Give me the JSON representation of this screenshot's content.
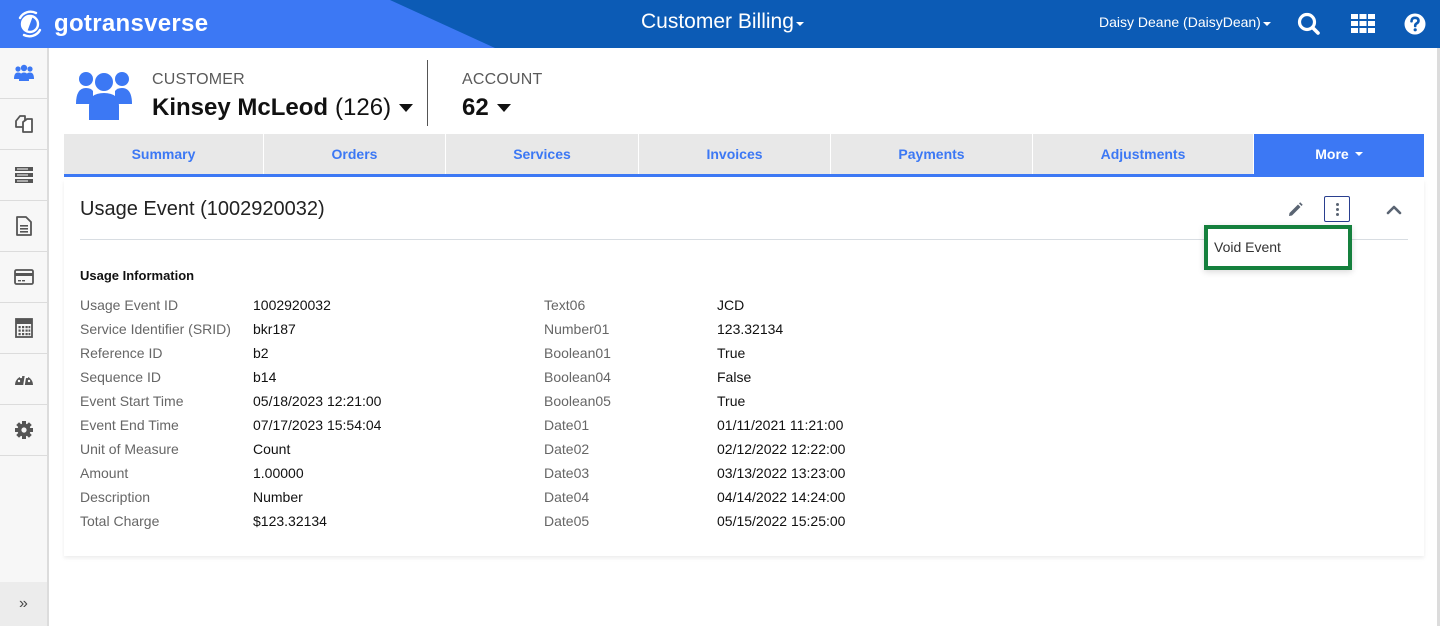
{
  "topbar": {
    "brand": "gotransverse",
    "app_title": "Customer Billing",
    "user": "Daisy Deane (DaisyDean)",
    "icons": [
      "search-icon",
      "apps-grid-icon",
      "help-icon"
    ]
  },
  "sidebar": {
    "items": [
      {
        "icon": "customers-icon",
        "label": "Customers",
        "active": true
      },
      {
        "icon": "copy-icon",
        "label": "Products"
      },
      {
        "icon": "server-icon",
        "label": "Services"
      },
      {
        "icon": "document-icon",
        "label": "Documents"
      },
      {
        "icon": "credit-card-icon",
        "label": "Payments"
      },
      {
        "icon": "calculator-icon",
        "label": "Calculator"
      },
      {
        "icon": "dashboard-icon",
        "label": "Dashboard"
      },
      {
        "icon": "gear-icon",
        "label": "Settings"
      }
    ],
    "expand_label": "»"
  },
  "header": {
    "customer_label": "CUSTOMER",
    "customer_name": "Kinsey McLeod",
    "customer_id": "(126)",
    "account_label": "ACCOUNT",
    "account_number": "62"
  },
  "tabs": [
    {
      "label": "Summary"
    },
    {
      "label": "Orders"
    },
    {
      "label": "Services"
    },
    {
      "label": "Invoices"
    },
    {
      "label": "Payments"
    },
    {
      "label": "Adjustments"
    },
    {
      "label": "More",
      "active": true
    }
  ],
  "panel": {
    "title": "Usage Event (1002920032)",
    "menu_items": [
      "Void Event"
    ],
    "section_title": "Usage Information",
    "left_fields": [
      {
        "label": "Usage Event ID",
        "value": "1002920032"
      },
      {
        "label": "Service Identifier (SRID)",
        "value": "bkr187"
      },
      {
        "label": "Reference ID",
        "value": "b2"
      },
      {
        "label": "Sequence ID",
        "value": "b14"
      },
      {
        "label": "Event Start Time",
        "value": "05/18/2023 12:21:00"
      },
      {
        "label": "Event End Time",
        "value": "07/17/2023 15:54:04"
      },
      {
        "label": "Unit of Measure",
        "value": "Count"
      },
      {
        "label": "Amount",
        "value": "1.00000"
      },
      {
        "label": "Description",
        "value": "Number"
      },
      {
        "label": "Total Charge",
        "value": "$123.32134"
      }
    ],
    "right_fields": [
      {
        "label": "Text06",
        "value": "JCD"
      },
      {
        "label": "Number01",
        "value": "123.32134"
      },
      {
        "label": "Boolean01",
        "value": "True"
      },
      {
        "label": "Boolean04",
        "value": "False"
      },
      {
        "label": "Boolean05",
        "value": "True"
      },
      {
        "label": "Date01",
        "value": "01/11/2021 11:21:00"
      },
      {
        "label": "Date02",
        "value": "02/12/2022 12:22:00"
      },
      {
        "label": "Date03",
        "value": "03/13/2022 13:23:00"
      },
      {
        "label": "Date04",
        "value": "04/14/2022 14:24:00"
      },
      {
        "label": "Date05",
        "value": "05/15/2022 15:25:00"
      }
    ]
  },
  "colors": {
    "brand_blue": "#3c78f4",
    "topbar_blue": "#0c5bb5",
    "highlight_green": "#15803d"
  }
}
